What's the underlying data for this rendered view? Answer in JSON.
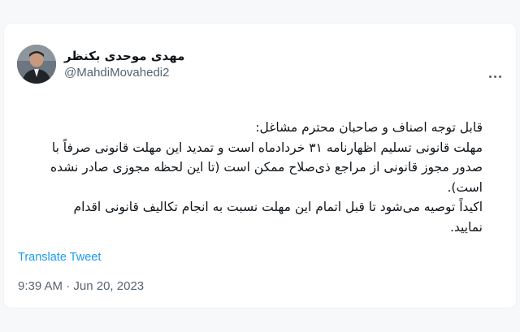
{
  "tweet": {
    "display_name": "مهدی موحدی بکنظر",
    "handle": "@MahdiMovahedi2",
    "more_icon": "more-horizontal-icon",
    "body_lines": [
      "قابل توجه اصناف و صاحبان محترم مشاغل:",
      "مهلت قانونی تسلیم اظهارنامه ۳۱ خردادماه است و تمدید این مهلت قانونی صرفاً با",
      "صدور مجوز قانونی از مراجع ذی‌صلاح ممکن است (تا این لحظه مجوزی صادر نشده",
      "است).",
      "اکیداً توصیه می‌شود تا قبل اتمام این مهلت نسبت به انجام تکالیف قانونی اقدام",
      "نمایید."
    ],
    "translate_label": "Translate Tweet",
    "time": "9:39 AM",
    "separator": " · ",
    "date": "Jun 20, 2023"
  },
  "colors": {
    "background": "#f6f8f9",
    "card": "#ffffff",
    "text": "#0f1419",
    "secondary": "#536471",
    "link": "#1d9bf0"
  }
}
